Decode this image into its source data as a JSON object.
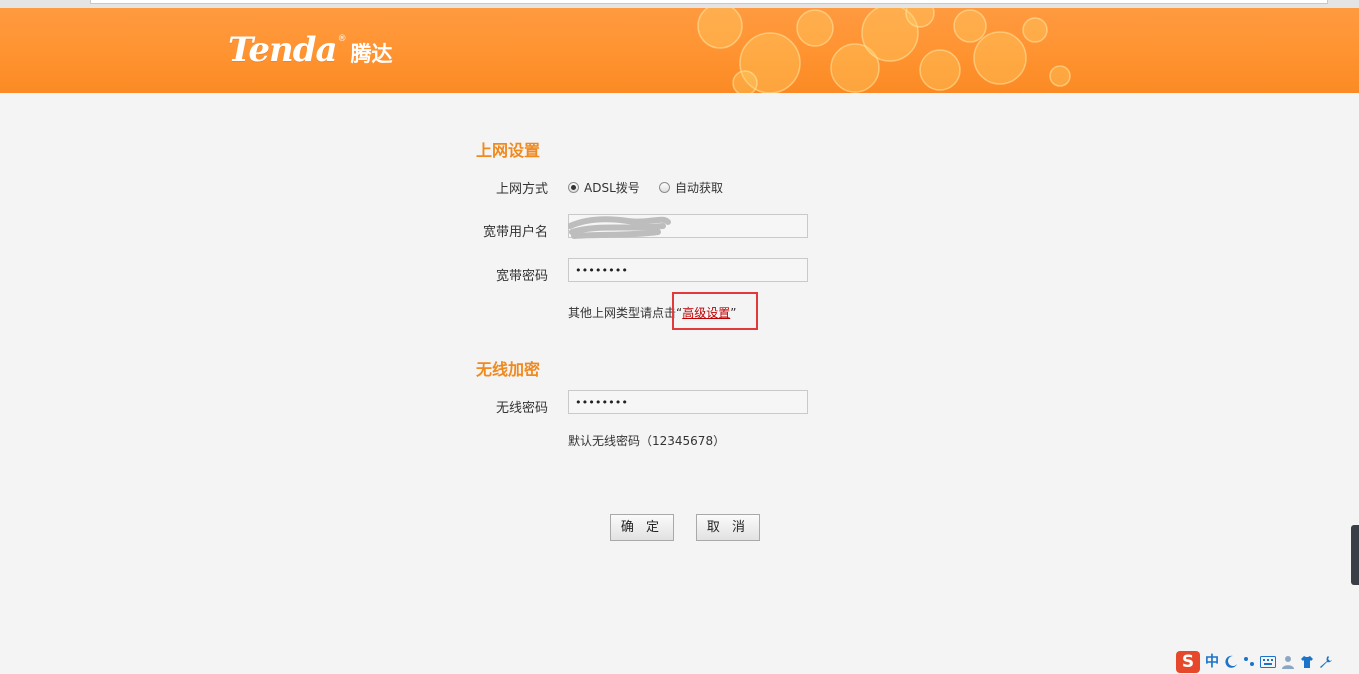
{
  "header": {
    "brand": "Tenda",
    "brand_mark": "®",
    "brand_cn": "腾达"
  },
  "internet": {
    "title": "上网设置",
    "mode_label": "上网方式",
    "mode_options": [
      "ADSL拨号",
      "自动获取"
    ],
    "mode_selected": "ADSL拨号",
    "username_label": "宽带用户名",
    "password_label": "宽带密码",
    "password_value": "••••••••",
    "hint_prefix": "其他上网类型请点击",
    "hint_open_quote": "“",
    "hint_link": "高级设置",
    "hint_close_quote": "”"
  },
  "wireless": {
    "title": "无线加密",
    "password_label": "无线密码",
    "password_value": "••••••••",
    "default_hint": "默认无线密码（12345678）"
  },
  "buttons": {
    "confirm": "确 定",
    "cancel": "取 消"
  },
  "ime": {
    "logo": "S",
    "lang": "中",
    "icons": [
      "moon-icon",
      "punctuation-icon",
      "keyboard-icon",
      "user-icon",
      "shirt-icon",
      "wrench-icon"
    ]
  }
}
